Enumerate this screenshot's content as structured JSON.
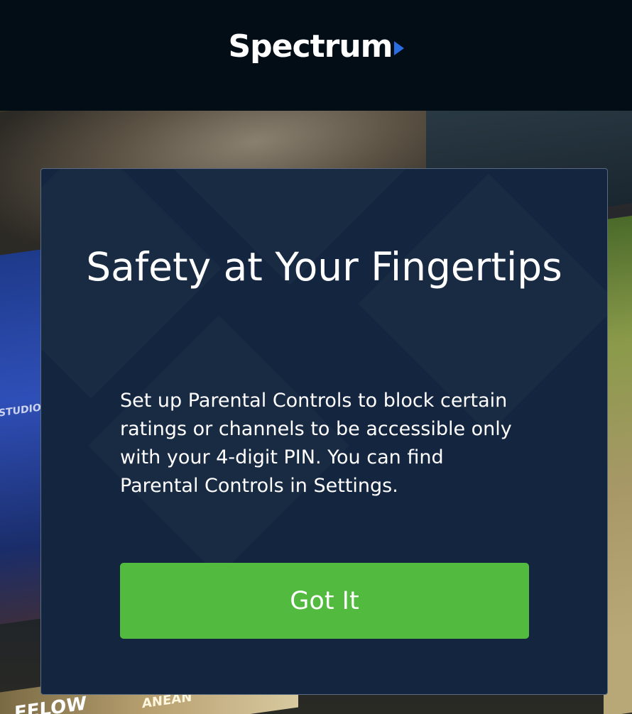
{
  "header": {
    "logo_text": "Spectrum"
  },
  "background": {
    "studio_label": "STUDIO",
    "bottom_label": "FELOW",
    "bottom_label_2": "ANEAN"
  },
  "modal": {
    "title": "Safety at Your Fingertips",
    "body": "Set up Parental Controls to block certain ratings or channels to be accessible only with your 4-digit PIN. You can find Parental Controls in Settings.",
    "button_label": "Got It"
  },
  "colors": {
    "header_bg": "#020d16",
    "modal_bg": "#14253f",
    "button_green": "#52ba3f",
    "logo_arrow_blue": "#2a6de0"
  }
}
